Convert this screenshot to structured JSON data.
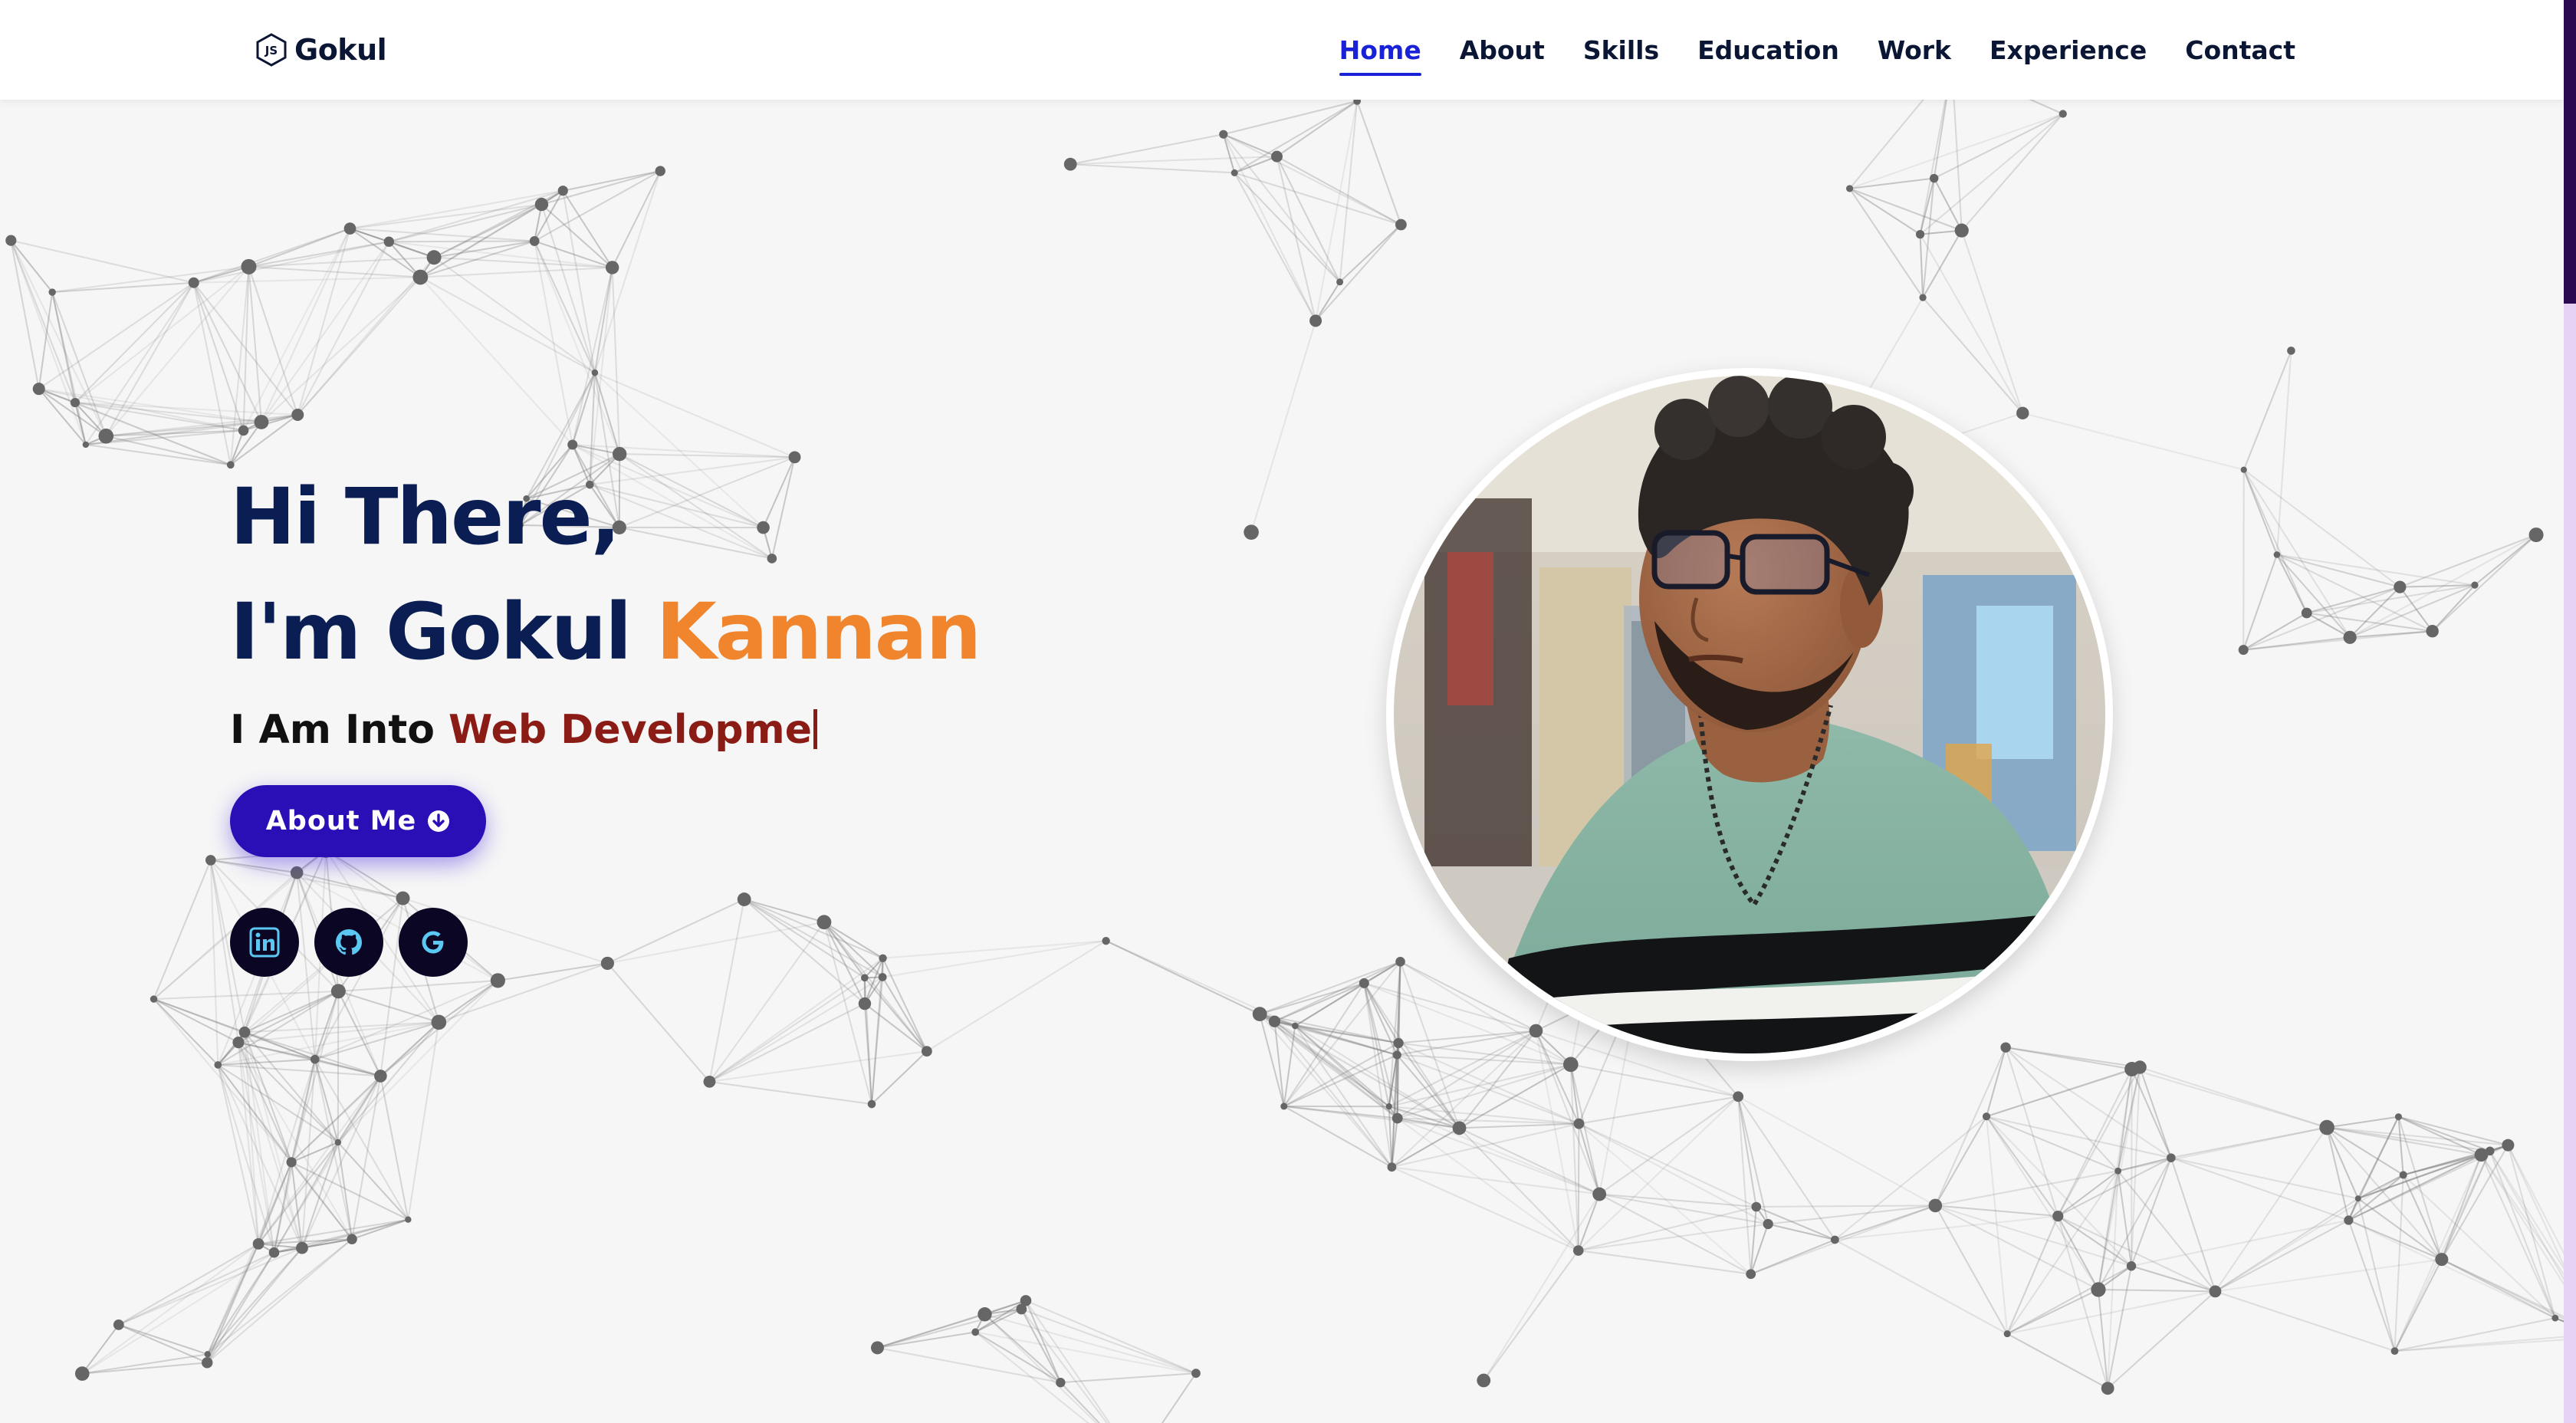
{
  "brand": {
    "name": "Gokul",
    "icon": "js-hexagon-icon"
  },
  "nav": {
    "active": "Home",
    "items": [
      "Home",
      "About",
      "Skills",
      "Education",
      "Work",
      "Experience",
      "Contact"
    ]
  },
  "hero": {
    "greeting": "Hi There,",
    "name_prefix": "I'm Gokul ",
    "name_accent": "Kannan",
    "tagline_prefix": "I Am Into ",
    "tagline_typed": "Web Developme",
    "about_button": "About Me",
    "about_button_icon": "arrow-circle-down-icon"
  },
  "socials": [
    {
      "name": "linkedin",
      "icon": "linkedin-icon"
    },
    {
      "name": "github",
      "icon": "github-icon"
    },
    {
      "name": "google",
      "icon": "google-icon"
    }
  ],
  "profile_photo": {
    "alt": "portrait-photo"
  },
  "colors": {
    "nav_active": "#1a22d8",
    "heading": "#0b1e54",
    "name_accent": "#f0852d",
    "tagline_accent": "#8a1b15",
    "button": "#2a0eb6",
    "scrollbar_thumb": "#2b0a52",
    "scrollbar_track": "#e6d3f4"
  }
}
